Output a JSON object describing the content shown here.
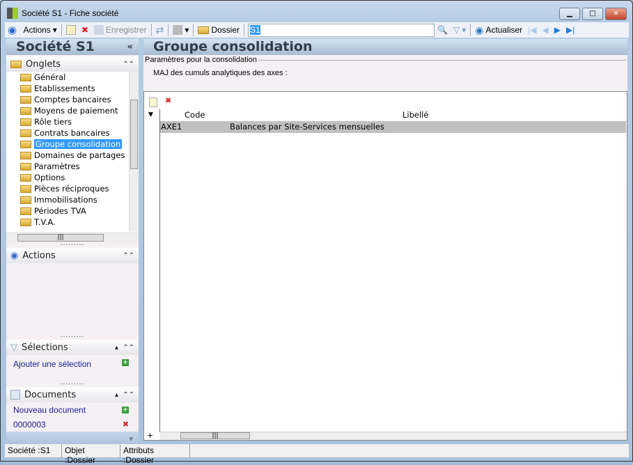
{
  "window": {
    "title": "Société S1 -  Fiche société"
  },
  "toolbar": {
    "actions": "Actions",
    "save": "Enregistrer",
    "folder": "Dossier",
    "search_value": "S1",
    "refresh": "Actualiser"
  },
  "left": {
    "title": "Société S1",
    "tabs_label": "Onglets",
    "tree": [
      "Général",
      "Etablissements",
      "Comptes bancaires",
      "Moyens de paiement",
      "Rôle tiers",
      "Contrats bancaires",
      "Groupe consolidation",
      "Domaines de partages",
      "Paramètres",
      "Options",
      "Pièces réciproques",
      "Immobilisations",
      "Périodes TVA",
      "T.V.A."
    ],
    "selected": "Groupe consolidation",
    "actions_label": "Actions",
    "selections_label": "Sélections",
    "add_selection": "Ajouter une sélection",
    "documents_label": "Documents",
    "new_document": "Nouveau document",
    "document_item": "0000003"
  },
  "main": {
    "title": "Groupe consolidation",
    "group_label": "Paramètres pour la consolidation",
    "field_label": "MAJ des cumuls analytiques des axes :",
    "columns": [
      "Code",
      "Libellé"
    ],
    "rows": [
      {
        "code": "AXE1",
        "label": "Balances par Site-Services mensuelles"
      }
    ]
  },
  "status": {
    "company": "Société :S1",
    "object": "Objet :Dossier",
    "attributes": "Attributs :Dossier"
  }
}
